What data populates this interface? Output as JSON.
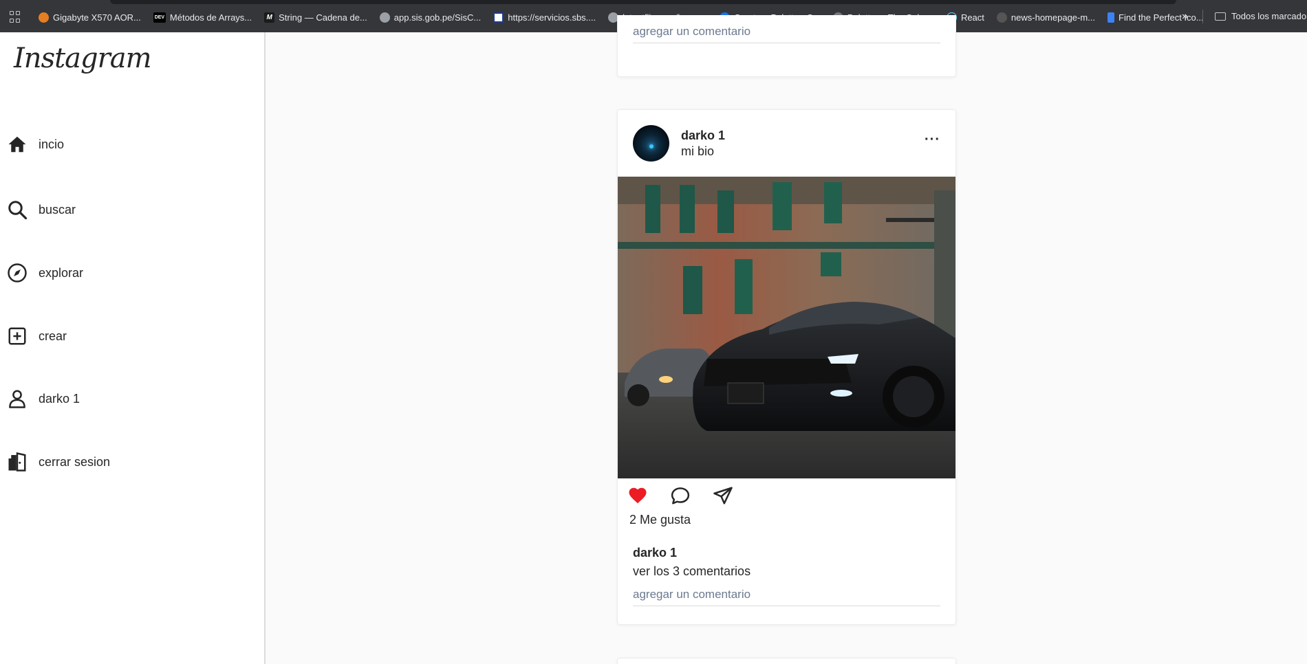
{
  "bookmarks": [
    {
      "label": "Gigabyte X570 AOR...",
      "icon": "gigabyte-favicon",
      "color": "#e67e22"
    },
    {
      "label": "Métodos de Arrays...",
      "icon": "dev-favicon",
      "color": "#000000"
    },
    {
      "label": "String — Cadena de...",
      "icon": "mdn-favicon",
      "color": "#1b1b1b"
    },
    {
      "label": "app.sis.gob.pe/SisC...",
      "icon": "globe-favicon",
      "color": "#9aa0a6"
    },
    {
      "label": "https://servicios.sbs....",
      "icon": "sbs-favicon",
      "color": "#1f3b8f"
    },
    {
      "label": "latentflip.com/loupe...",
      "icon": "globe-favicon",
      "color": "#9aa0a6"
    },
    {
      "label": "Create a Palette - C...",
      "icon": "coolors-favicon",
      "color": "#1a73e8"
    },
    {
      "label": "Paletton - The Color...",
      "icon": "paletton-favicon",
      "color": "#777777"
    },
    {
      "label": "React",
      "icon": "react-favicon",
      "color": "#61dafb"
    },
    {
      "label": "news-homepage-m...",
      "icon": "github-favicon",
      "color": "#ffffff"
    },
    {
      "label": "Find the Perfect Ico...",
      "icon": "flag-favicon",
      "color": "#3b82f6"
    }
  ],
  "bookmarks_more": "»",
  "bookmarks_folder": "Todos los marcadores",
  "sidebar": {
    "logo": "Instagram",
    "items": [
      {
        "label": "incio",
        "icon": "home-icon"
      },
      {
        "label": "buscar",
        "icon": "search-icon"
      },
      {
        "label": "explorar",
        "icon": "compass-icon"
      },
      {
        "label": "crear",
        "icon": "plus-square-icon"
      },
      {
        "label": "darko 1",
        "icon": "user-icon"
      },
      {
        "label": "cerrar sesion",
        "icon": "logout-door-icon"
      }
    ]
  },
  "post_top": {
    "comment_placeholder": "agregar un comentario"
  },
  "post": {
    "username": "darko 1",
    "bio": "mi bio",
    "more": "···",
    "likes": "2 Me gusta",
    "caption_user": "darko 1",
    "view_comments": "ver los 3 comentarios",
    "comment_placeholder": "agregar un comentario",
    "liked": true,
    "like_color": "#ed1c24"
  }
}
